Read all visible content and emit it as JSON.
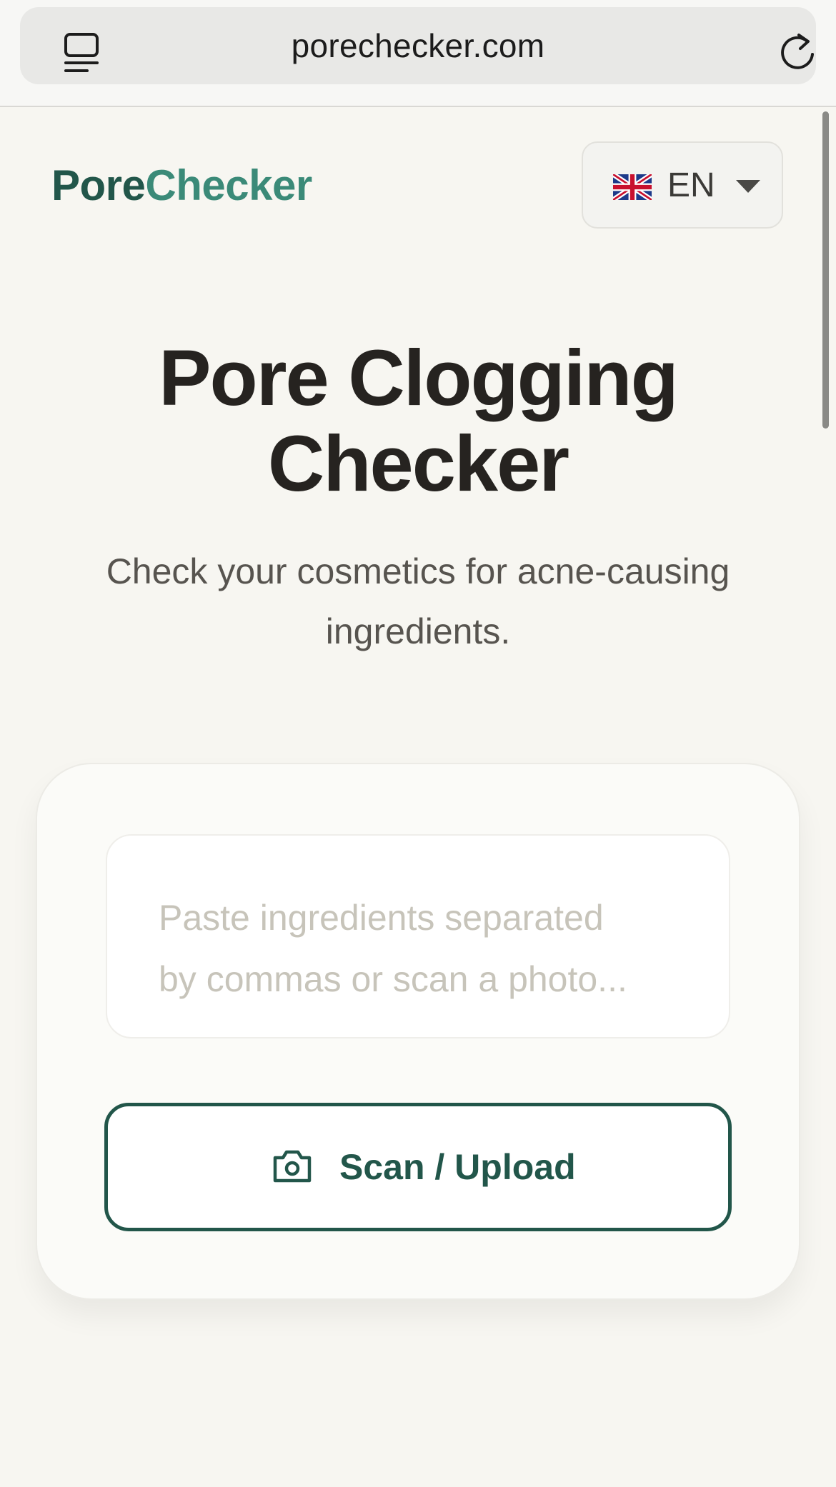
{
  "browser": {
    "url": "porechecker.com",
    "tab_icon": "tabs-icon",
    "reload_icon": "reload-icon"
  },
  "header": {
    "logo_part1": "Pore",
    "logo_part2": "Checker",
    "language": {
      "code": "EN",
      "flag_icon": "uk-flag-icon",
      "dropdown_icon": "caret-down-icon"
    }
  },
  "hero": {
    "title_line1": "Pore Clogging",
    "title_line2": "Checker",
    "subtitle": "Check your cosmetics for acne-causing ingredients."
  },
  "form": {
    "placeholder_line1": "Paste ingredients separated",
    "placeholder_line2": "by commas or scan a photo...",
    "placeholder": "Paste ingredients separated by commas or scan a photo...",
    "value": "",
    "scan_button_label": "Scan / Upload",
    "scan_icon": "camera-icon"
  },
  "colors": {
    "brand_dark": "#22564a",
    "brand_light": "#3b8a78",
    "background": "#f7f6f1",
    "text": "#262320"
  }
}
